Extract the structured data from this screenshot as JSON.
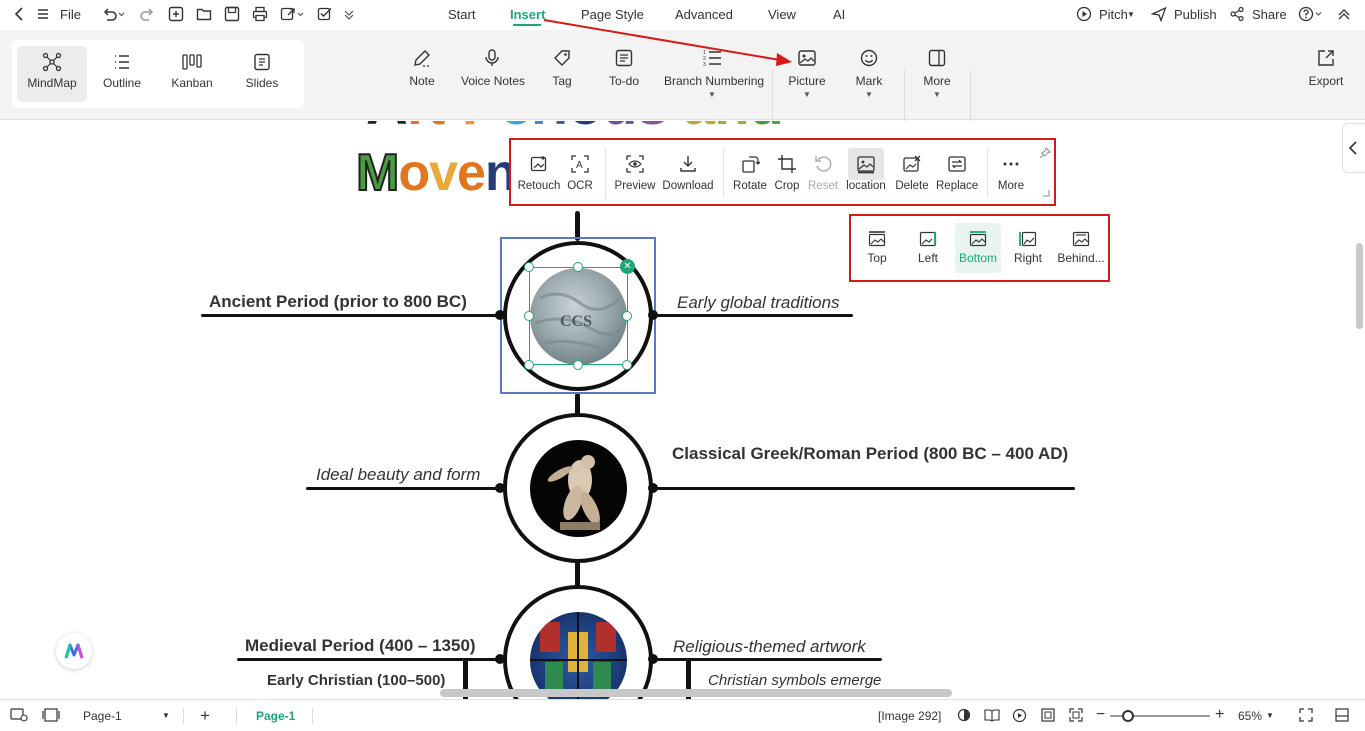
{
  "menubar": {
    "file_label": "File",
    "tabs": [
      {
        "label": "Start"
      },
      {
        "label": "Insert"
      },
      {
        "label": "Page Style"
      },
      {
        "label": "Advanced"
      },
      {
        "label": "View"
      },
      {
        "label": "AI"
      }
    ],
    "active_tab": "Insert",
    "pitch_label": "Pitch",
    "publish_label": "Publish",
    "share_label": "Share"
  },
  "views": [
    {
      "label": "MindMap",
      "icon": "mindmap-icon"
    },
    {
      "label": "Outline",
      "icon": "outline-icon"
    },
    {
      "label": "Kanban",
      "icon": "kanban-icon"
    },
    {
      "label": "Slides",
      "icon": "slides-icon"
    }
  ],
  "ribbon": {
    "note": "Note",
    "voice_notes": "Voice Notes",
    "tag": "Tag",
    "todo": "To-do",
    "branch_numbering": "Branch Numbering",
    "picture": "Picture",
    "mark": "Mark",
    "more": "More",
    "export": "Export"
  },
  "image_toolbar": {
    "retouch": "Retouch",
    "ocr": "OCR",
    "preview": "Preview",
    "download": "Download",
    "rotate": "Rotate",
    "crop": "Crop",
    "reset": "Reset",
    "location": "location",
    "delete": "Delete",
    "replace": "Replace",
    "more": "More"
  },
  "location_options": [
    {
      "label": "Top"
    },
    {
      "label": "Left"
    },
    {
      "label": "Bottom"
    },
    {
      "label": "Right"
    },
    {
      "label": "Behind..."
    }
  ],
  "selected_location": "Bottom",
  "mindmap": {
    "title_line1": "Art Periods and",
    "title_line2": "Movem",
    "nodes": [
      {
        "left": "Ancient Period (prior to 800 BC)",
        "right": "Early global traditions"
      },
      {
        "left": "Ideal beauty and form",
        "right": "Classical Greek/Roman Period (800 BC – 400 AD)"
      },
      {
        "left": "Medieval Period (400 – 1350)",
        "right": "Religious-themed artwork"
      }
    ],
    "sub_left": "Early Christian (100–500)",
    "sub_right": "Christian symbols emerge"
  },
  "statusbar": {
    "page_select": "Page-1",
    "page_tab": "Page-1",
    "image_count": "[Image 292]",
    "zoom": "65%"
  },
  "colors": {
    "accent": "#19a974",
    "annotation_red": "#d61a1a"
  }
}
